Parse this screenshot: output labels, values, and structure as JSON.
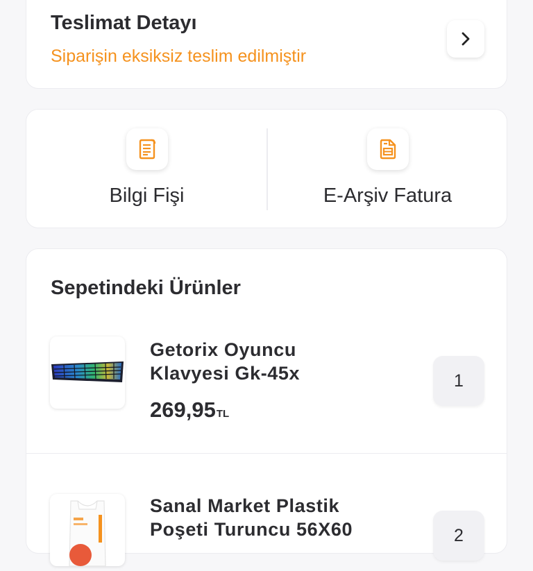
{
  "delivery": {
    "title": "Teslimat Detayı",
    "status": "Siparişin eksiksiz teslim edilmiştir",
    "status_color": "#f5921e",
    "chevron_icon": "chevron-right-icon"
  },
  "documents": [
    {
      "label": "Bilgi Fişi",
      "icon": "receipt-icon"
    },
    {
      "label": "E-Arşiv Fatura",
      "icon": "invoice-document-icon"
    }
  ],
  "cart": {
    "title": "Sepetindeki Ürünler",
    "items": [
      {
        "name": "Getorix Oyuncu Klavyesi Gk-45x",
        "price": "269,95",
        "currency": "TL",
        "quantity": "1",
        "thumb_icon": "keyboard-image"
      },
      {
        "name": "Sanal Market Plastik Poşeti Turuncu 56X60",
        "price": "",
        "currency": "",
        "quantity": "2",
        "thumb_icon": "plastic-bag-image"
      }
    ]
  },
  "colors": {
    "accent": "#f5921e",
    "text": "#2c2c30",
    "card_border": "#ececf0",
    "qty_bg": "#f1f1f4"
  }
}
